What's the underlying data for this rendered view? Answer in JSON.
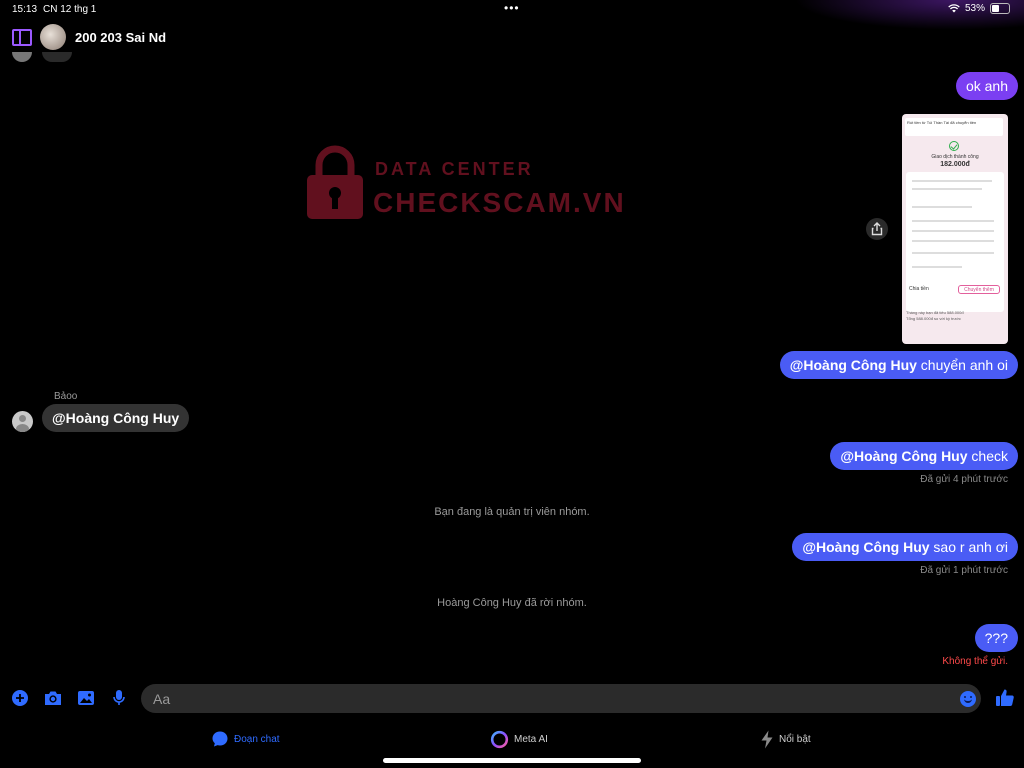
{
  "status_bar": {
    "time": "15:13",
    "date": "CN 12 thg 1",
    "battery": "53%",
    "battery_level": 0.53
  },
  "header": {
    "title": "200 203 Sai Nd"
  },
  "watermark": {
    "line1": "DATA CENTER",
    "line2": "CHECKSCAM.VN",
    "color": "#7a1426"
  },
  "receipt": {
    "banner": "Rút tiền từ Túi Thần Tài đã chuyển tiền",
    "status": "Giao dịch thành công",
    "amount": "182.000đ",
    "transfer_button": "Chuyển thêm",
    "share_button": "Chia tiền",
    "footer_line1": "Tháng này bạn đã tiêu 588.000đ",
    "footer_line2": "Tổng 588.000đ so với kỳ trước"
  },
  "messages": [
    {
      "dir": "out",
      "mention": "",
      "text": "ok anh"
    },
    {
      "dir": "out",
      "mention": "@Hoàng Công Huy",
      "text": " chuyển anh oi"
    },
    {
      "dir": "in",
      "sender": "Bảoo",
      "mention": "@Hoàng Công Huy",
      "text": ""
    },
    {
      "dir": "out",
      "mention": "@Hoàng Công Huy",
      "text": " check",
      "status": "Đã gửi 4 phút trước"
    },
    {
      "dir": "out",
      "mention": "@Hoàng Công Huy",
      "text": " sao r anh ơi",
      "status": "Đã gửi 1 phút trước"
    },
    {
      "dir": "out",
      "mention": "",
      "text": "???",
      "status": "Không thể gửi."
    }
  ],
  "system_messages": [
    "Bạn đang là quản trị viên nhóm.",
    "Hoàng Công Huy đã rời nhóm."
  ],
  "composer": {
    "placeholder": "Aa"
  },
  "tabs": [
    {
      "label": "Đoạn chat",
      "active": true
    },
    {
      "label": "Meta AI",
      "active": false
    },
    {
      "label": "Nổi bật",
      "active": false
    }
  ],
  "colors": {
    "accent": "#2f6bff",
    "outgoing_bubble": "#4a5cf5",
    "first_bubble": "#7b3ff2",
    "incoming_bubble": "#333333",
    "error": "#ff4a4a",
    "sidebar_icon": "#9b59ff"
  }
}
